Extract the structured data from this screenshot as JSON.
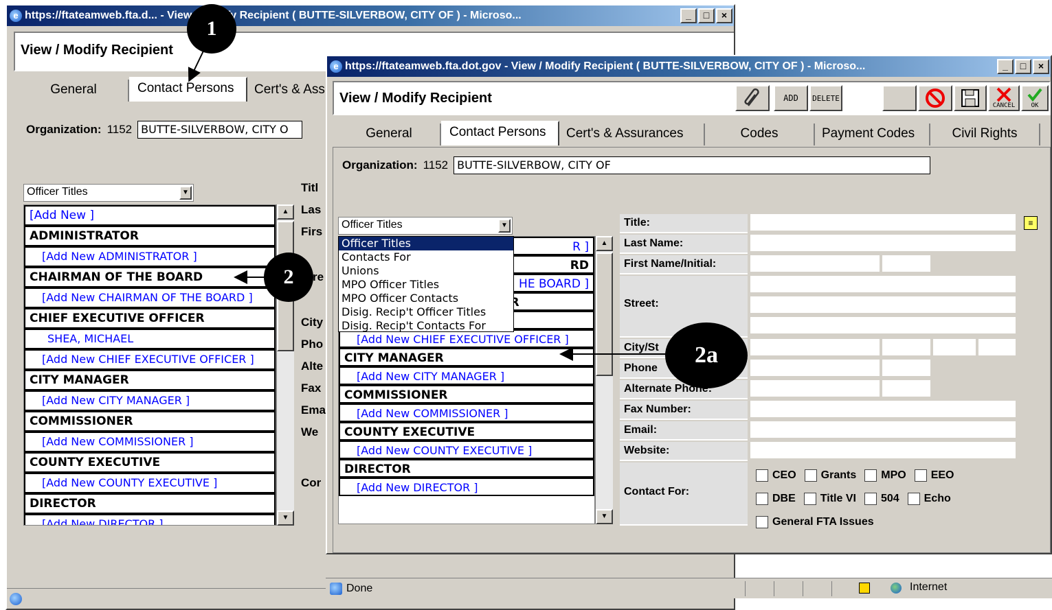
{
  "back_window": {
    "title": "https://ftateamweb.fta.d... - View / Modify Recipient ( BUTTE-SILVERBOW, CITY OF ) - Microso...",
    "header_title": "View / Modify Recipient",
    "tabs": [
      "General",
      "Contact Persons",
      "Cert's & Ass"
    ],
    "org_label": "Organization:",
    "org_number": "1152",
    "org_name": "BUTTE-SILVERBOW, CITY O",
    "select_value": "Officer Titles",
    "list": [
      {
        "text": "[Add New ]",
        "kind": "link0"
      },
      {
        "text": "ADMINISTRATOR",
        "kind": "head"
      },
      {
        "text": "[Add New ADMINISTRATOR ]",
        "kind": "link"
      },
      {
        "text": "CHAIRMAN OF THE BOARD",
        "kind": "head"
      },
      {
        "text": "[Add New CHAIRMAN OF THE BOARD ]",
        "kind": "link"
      },
      {
        "text": "CHIEF EXECUTIVE OFFICER",
        "kind": "head"
      },
      {
        "text": "SHEA, MICHAEL",
        "kind": "person"
      },
      {
        "text": "[Add New CHIEF EXECUTIVE OFFICER ]",
        "kind": "link"
      },
      {
        "text": "CITY MANAGER",
        "kind": "head"
      },
      {
        "text": "[Add New CITY MANAGER ]",
        "kind": "link"
      },
      {
        "text": "COMMISSIONER",
        "kind": "head"
      },
      {
        "text": "[Add New COMMISSIONER ]",
        "kind": "link"
      },
      {
        "text": "COUNTY EXECUTIVE",
        "kind": "head"
      },
      {
        "text": "[Add New COUNTY EXECUTIVE ]",
        "kind": "link"
      },
      {
        "text": "DIRECTOR",
        "kind": "head"
      },
      {
        "text": "[Add New DIRECTOR ]",
        "kind": "link"
      }
    ],
    "side_labels": [
      "Titl",
      "Las",
      "Firs",
      "Stre",
      "City",
      "Pho",
      "Alte",
      "Fax",
      "Ema",
      "We",
      "Cor"
    ]
  },
  "front_window": {
    "title": "https://ftateamweb.fta.dot.gov - View / Modify Recipient ( BUTTE-SILVERBOW, CITY OF ) - Microso...",
    "header_title": "View / Modify Recipient",
    "toolbar": {
      "add": "ADD",
      "delete": "DELETE",
      "cancel": "CANCEL",
      "ok": "OK"
    },
    "tabs": [
      "General",
      "Contact Persons",
      "Cert's & Assurances",
      "Codes",
      "Payment Codes",
      "Civil Rights"
    ],
    "org_label": "Organization:",
    "org_number": "1152",
    "org_name": "BUTTE-SILVERBOW, CITY OF",
    "select_value": "Officer Titles",
    "dropdown_options": [
      "Officer Titles",
      "Contacts For",
      "Unions",
      "MPO Officer Titles",
      "MPO Officer Contacts",
      "Disig. Recip't Officer Titles",
      "Disig. Recip't Contacts For"
    ],
    "list_visible": [
      {
        "text": "R ]",
        "kind": "partial"
      },
      {
        "text": "RD",
        "kind": "partial-bold"
      },
      {
        "text": "HE BOARD ]",
        "kind": "partial"
      },
      {
        "text": "CHIEF EXECUTIVE OFFICER",
        "kind": "head"
      },
      {
        "text": "SHEA, MICHAEL",
        "kind": "person"
      },
      {
        "text": "[Add New CHIEF EXECUTIVE OFFICER ]",
        "kind": "link"
      },
      {
        "text": "CITY MANAGER",
        "kind": "head"
      },
      {
        "text": "[Add New CITY MANAGER ]",
        "kind": "link"
      },
      {
        "text": "COMMISSIONER",
        "kind": "head"
      },
      {
        "text": "[Add New COMMISSIONER ]",
        "kind": "link"
      },
      {
        "text": "COUNTY EXECUTIVE",
        "kind": "head"
      },
      {
        "text": "[Add New COUNTY EXECUTIVE ]",
        "kind": "link"
      },
      {
        "text": "DIRECTOR",
        "kind": "head"
      },
      {
        "text": "[Add New DIRECTOR ]",
        "kind": "link"
      }
    ],
    "form": {
      "title": "Title:",
      "last_name": "Last Name:",
      "first_name": "First Name/Initial:",
      "street": "Street:",
      "city": "City/St",
      "phone": "Phone",
      "alt_phone": "Alternate Phone:",
      "fax": "Fax Number:",
      "email": "Email:",
      "website": "Website:",
      "contact_for": "Contact For:"
    },
    "contact_for_options": [
      "CEO",
      "Grants",
      "MPO",
      "EEO",
      "DBE",
      "Title VI",
      "504",
      "Echo",
      "General FTA Issues"
    ],
    "status": {
      "done": "Done",
      "zone": "Internet"
    }
  },
  "callouts": {
    "c1": "1",
    "c2": "2",
    "c2a": "2a"
  },
  "colors": {
    "titlebar": "#0a246a",
    "link": "#0000ff",
    "chrome": "#d4d0c8"
  }
}
